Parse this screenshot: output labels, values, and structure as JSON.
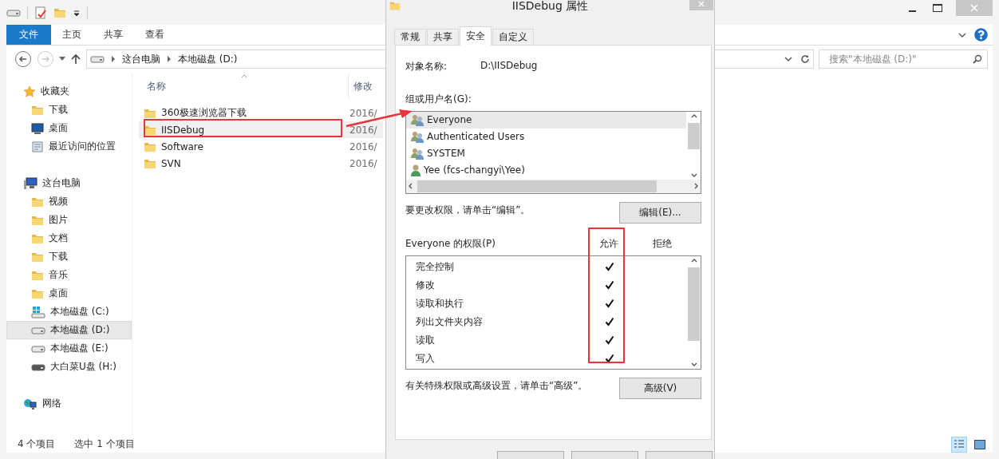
{
  "explorer": {
    "ribbon_tabs": [
      {
        "label": "文件",
        "kind": "file"
      },
      {
        "label": "主页",
        "kind": "tab"
      },
      {
        "label": "共享",
        "kind": "tab"
      },
      {
        "label": "查看",
        "kind": "tab"
      }
    ],
    "address": {
      "crumbs": [
        "这台电脑",
        "本地磁盘 (D:)"
      ]
    },
    "search": {
      "placeholder": "搜索\"本地磁盘 (D:)\""
    },
    "columns": [
      "名称",
      "修改"
    ],
    "files": [
      {
        "name": "360极速浏览器下载",
        "date": "2016/",
        "selected": false,
        "highlighted": false
      },
      {
        "name": "IISDebug",
        "date": "2016/",
        "selected": true,
        "highlighted": true
      },
      {
        "name": "Software",
        "date": "2016/",
        "selected": false,
        "highlighted": false
      },
      {
        "name": "SVN",
        "date": "2016/",
        "selected": false,
        "highlighted": false
      }
    ],
    "navigation": [
      {
        "label": "收藏夹",
        "kind": "star",
        "selected": false,
        "children": [
          {
            "label": "下载",
            "kind": "folder",
            "selected": false
          },
          {
            "label": "桌面",
            "kind": "monitor",
            "selected": false
          },
          {
            "label": "最近访问的位置",
            "kind": "recent",
            "selected": false
          }
        ]
      },
      {
        "label": "这台电脑",
        "kind": "pc",
        "selected": false,
        "children": [
          {
            "label": "视频",
            "kind": "folder",
            "selected": false
          },
          {
            "label": "图片",
            "kind": "folder",
            "selected": false
          },
          {
            "label": "文档",
            "kind": "folder",
            "selected": false
          },
          {
            "label": "下载",
            "kind": "folder",
            "selected": false
          },
          {
            "label": "音乐",
            "kind": "folder",
            "selected": false
          },
          {
            "label": "桌面",
            "kind": "folder",
            "selected": false
          },
          {
            "label": "本地磁盘 (C:)",
            "kind": "system",
            "selected": false
          },
          {
            "label": "本地磁盘 (D:)",
            "kind": "drive",
            "selected": true
          },
          {
            "label": "本地磁盘 (E:)",
            "kind": "drive",
            "selected": false
          },
          {
            "label": "大白菜U盘 (H:)",
            "kind": "usb",
            "selected": false
          }
        ]
      },
      {
        "label": "网络",
        "kind": "network",
        "selected": false
      }
    ],
    "status": [
      "4 个项目",
      "选中 1 个项目"
    ]
  },
  "dialog": {
    "title": "IISDebug 属性",
    "tabs": [
      {
        "label": "常规",
        "selected": false
      },
      {
        "label": "共享",
        "selected": false
      },
      {
        "label": "安全",
        "selected": true
      },
      {
        "label": "自定义",
        "selected": false
      }
    ],
    "object_label": "对象名称:",
    "object_value": "D:\\IISDebug",
    "groups_label": "组或用户名(G):",
    "users": [
      {
        "name": "Everyone",
        "kind": "group",
        "selected": true
      },
      {
        "name": "Authenticated Users",
        "kind": "group",
        "selected": false
      },
      {
        "name": "SYSTEM",
        "kind": "group",
        "selected": false
      },
      {
        "name": "Yee (fcs-changyi\\Yee)",
        "kind": "user",
        "selected": false
      }
    ],
    "edit_hint": "要更改权限，请单击“编辑”。",
    "edit_button": "编辑(E)...",
    "permissions_label": "Everyone 的权限(P)",
    "allow_header": "允许",
    "deny_header": "拒绝",
    "allow_highlighted": true,
    "permissions": [
      {
        "name": "完全控制",
        "allow": true,
        "deny": false
      },
      {
        "name": "修改",
        "allow": true,
        "deny": false
      },
      {
        "name": "读取和执行",
        "allow": true,
        "deny": false
      },
      {
        "name": "列出文件夹内容",
        "allow": true,
        "deny": false
      },
      {
        "name": "读取",
        "allow": true,
        "deny": false
      },
      {
        "name": "写入",
        "allow": true,
        "deny": false
      }
    ],
    "advanced_hint": "有关特殊权限或高级设置，请单击“高级”。",
    "advanced_button": "高级(V)"
  },
  "annotations": [
    {
      "kind": "arrow"
    }
  ]
}
